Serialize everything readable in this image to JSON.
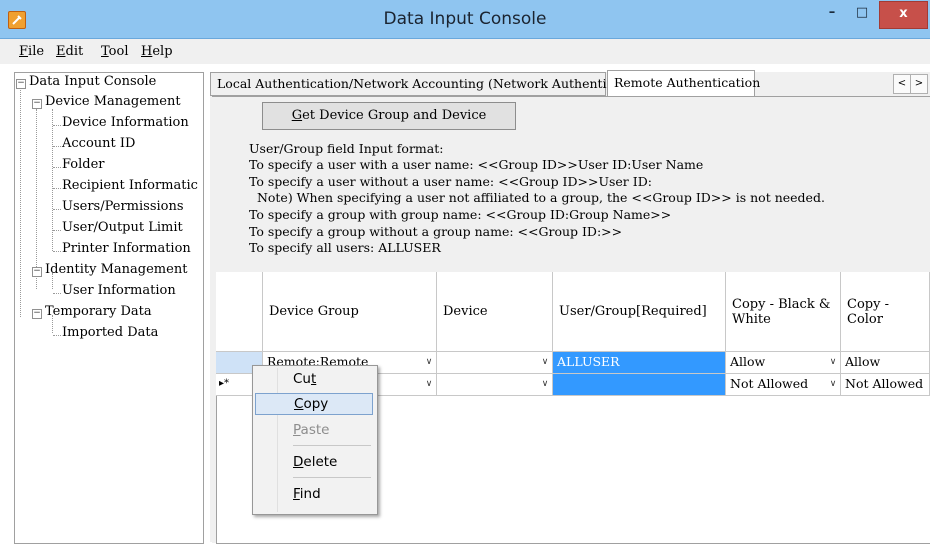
{
  "window": {
    "title": "Data Input Console",
    "icon": "app-icon",
    "minimize": "–",
    "maximize": "□",
    "close": "x"
  },
  "menu": [
    {
      "pre": "",
      "key": "F",
      "post": "ile"
    },
    {
      "pre": "",
      "key": "E",
      "post": "dit"
    },
    {
      "pre": "",
      "key": "T",
      "post": "ool"
    },
    {
      "pre": "",
      "key": "H",
      "post": "elp"
    }
  ],
  "tree": {
    "root": "Data Input Console",
    "device_management": "Device Management",
    "device_information": "Device Information",
    "account_id": "Account ID",
    "folder": "Folder",
    "recipient_information": "Recipient Informatic",
    "users_permissions": "Users/Permissions",
    "user_output_limit": "User/Output Limit",
    "printer_information": "Printer Information",
    "identity_management": "Identity Management",
    "user_information": "User Information",
    "temporary_data": "Temporary Data",
    "imported_data": "Imported Data"
  },
  "tabs": {
    "tab1": "Local Authentication/Network Accounting (Network Authentication)",
    "tab2": "Remote Authentication",
    "prev": "<",
    "next": ">"
  },
  "get_button": {
    "key": "G",
    "rest": "et Device Group and Device"
  },
  "info": [
    "User/Group field Input format:",
    "To specify a user with a user name: <<Group ID>>User ID:User Name",
    "To specify a user without a user name: <<Group ID>>User ID:",
    "  Note) When specifying a user not affiliated to a group, the <<Group ID>> is not needed.",
    "To specify a group with group name: <<Group ID:Group Name>>",
    "To specify a group without a group name: <<Group ID:>>",
    "To specify all users: ALLUSER"
  ],
  "grid": {
    "headers": [
      "Device Group",
      "Device",
      "User/Group[Required]",
      "Copy - Black & White",
      "Copy - Color"
    ],
    "rows": [
      {
        "marker": "",
        "device_group": "Remote:Remote",
        "device": "",
        "user_group": "ALLUSER",
        "copy_bw": "Allow",
        "copy_color": "Allow"
      },
      {
        "marker": "▸*",
        "device_group": "",
        "device": "",
        "user_group": "",
        "copy_bw": "Not Allowed",
        "copy_color": "Not Allowed"
      }
    ],
    "dropdown_glyph": "∨",
    "selection_color": "#3399ff"
  },
  "context_menu": [
    {
      "pre": "Cu",
      "key": "t",
      "post": "",
      "state": "normal"
    },
    {
      "pre": "",
      "key": "C",
      "post": "opy",
      "state": "highlighted"
    },
    {
      "pre": "",
      "key": "P",
      "post": "aste",
      "state": "disabled"
    },
    {
      "pre": "",
      "key": "D",
      "post": "elete",
      "state": "normal"
    },
    {
      "pre": "",
      "key": "F",
      "post": "ind",
      "state": "normal"
    }
  ],
  "colors": {
    "titlebar": "#8fc5f0",
    "close_button": "#c7504a",
    "selection": "#3399ff"
  }
}
